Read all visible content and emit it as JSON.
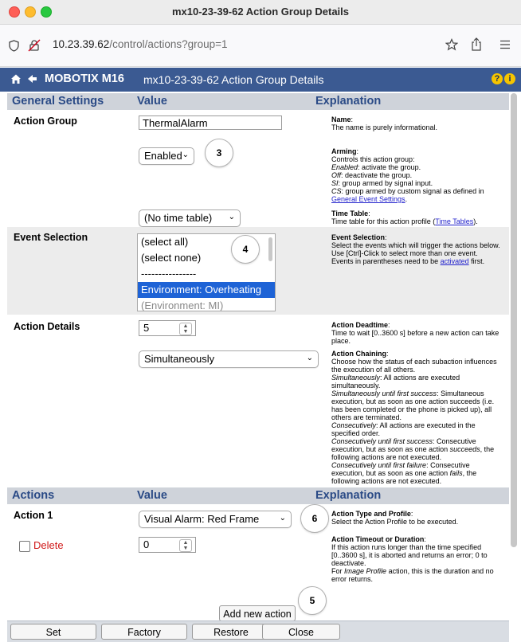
{
  "window": {
    "title": "mx10-23-39-62 Action Group Details"
  },
  "browser": {
    "url_host": "10.23.39.62",
    "url_path": "/control/actions?group=1"
  },
  "header": {
    "brand": "MOBOTIX M16",
    "title": "mx10-23-39-62 Action Group Details",
    "help_label": "?",
    "info_label": "i"
  },
  "general": {
    "heading": "General Settings",
    "value_heading": "Value",
    "explanation_heading": "Explanation",
    "action_group": {
      "label": "Action Group",
      "name_value": "ThermalAlarm",
      "arming_value": "Enabled",
      "timetable_value": "(No time table)"
    }
  },
  "explanations": {
    "name_title": "Name",
    "name_text": "The name is purely informational.",
    "arming_title": "Arming",
    "arming_intro": "Controls this action group:",
    "arming_enabled_term": "Enabled",
    "arming_enabled_text": ": activate the group.",
    "arming_off_term": "Off",
    "arming_off_text": ": deactivate the group.",
    "arming_si_term": "SI",
    "arming_si_text": ": group armed by signal input.",
    "arming_cs_term": "CS",
    "arming_cs_text": ": group armed by custom signal as defined in",
    "arming_link": "General Event Settings",
    "timetable_title": "Time Table",
    "timetable_text": "Time table for this action profile (",
    "timetable_link": "Time Tables",
    "timetable_end": ").",
    "events_title": "Event Selection",
    "events_text1": "Select the events which will trigger the actions below.",
    "events_text2": "Use [Ctrl]-Click to select more than one event.",
    "events_text3": "Events in parentheses need to be",
    "events_link": "activated",
    "events_end": "first.",
    "deadtime_title": "Action Deadtime",
    "deadtime_text": "Time to wait [0..3600 s] before a new action can take place.",
    "chaining_title": "Action Chaining",
    "chaining_text": "Choose how the status of each subaction influences the execution of all others.",
    "chain_sim_term": "Simultaneously",
    "chain_sim_text": ": All actions are executed simultaneously.",
    "chain_simfirst_term": "Simultaneously until first success",
    "chain_simfirst_text": ": Simultaneous execution, but as soon as one action succeeds (i.e. has been completed or the phone is picked up), all others are terminated.",
    "chain_cons_term": "Consecutively",
    "chain_cons_text": ": All actions are executed in the specified order.",
    "chain_consfirst_term": "Consecutively until first success",
    "chain_consfirst_text": ": Consecutive execution, but as soon as one action",
    "chain_consfirst_em": "succeeds",
    "chain_consfirst_end": ", the following actions are not executed.",
    "chain_consfail_term": "Consecutively until first failure",
    "chain_consfail_text": ": Consecutive execution, but as soon as one action",
    "chain_consfail_em": "fails",
    "chain_consfail_end": ", the following actions are not executed.",
    "actiontype_title": "Action Type and Profile",
    "actiontype_text": "Select the Action Profile to be executed.",
    "timeout_title": "Action Timeout or Duration",
    "timeout_text": "If this action runs longer than the time specified [0..3600 s], it is aborted and returns an error; 0 to deactivate.",
    "timeout_text2_pre": "For",
    "timeout_text2_em": "Image Profile",
    "timeout_text2_post": "action, this is the duration and no error returns."
  },
  "event_selection": {
    "label": "Event Selection",
    "options": [
      "(select all)",
      "(select none)",
      "----------------",
      "Environment: Overheating",
      "(Environment: MI)"
    ],
    "selected_index": 3
  },
  "action_details": {
    "label": "Action Details",
    "deadtime_value": "5",
    "chaining_value": "Simultaneously"
  },
  "actions": {
    "heading": "Actions",
    "value_heading": "Value",
    "explanation_heading": "Explanation",
    "action1_label": "Action 1",
    "delete_label": "Delete",
    "action1_profile": "Visual Alarm: Red Frame",
    "action1_timeout": "0",
    "add_button": "Add new action"
  },
  "callouts": [
    "3",
    "4",
    "6",
    "5"
  ],
  "footer": {
    "set": "Set",
    "factory": "Factory",
    "restore": "Restore",
    "close": "Close"
  },
  "colors": {
    "header_bg": "#3b5a92",
    "section_bg": "#cfd3da",
    "heading_text": "#2a4a86",
    "delete_red": "#d01818"
  }
}
